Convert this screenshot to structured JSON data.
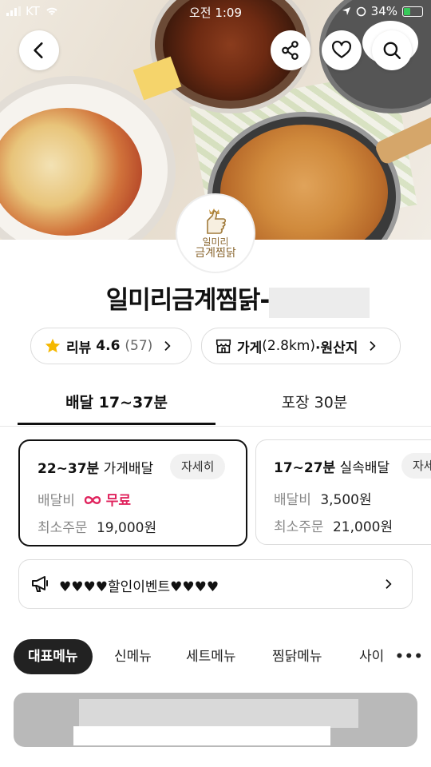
{
  "status_bar": {
    "carrier": "KT",
    "time": "오전 1:09",
    "battery": "34%"
  },
  "store": {
    "logo_text_1": "일미리",
    "logo_text_2": "금계찜닭",
    "name": "일미리금계찜닭-"
  },
  "review": {
    "label": "리뷰",
    "rating": "4.6",
    "count": "(57)"
  },
  "store_info": {
    "prefix": "가게",
    "distance": "(2.8km)",
    "suffix": "·원산지"
  },
  "tabs": {
    "delivery": "배달 17~37분",
    "pickup": "포장 30분"
  },
  "delivery_options": [
    {
      "time": "22~37분",
      "type": "가게배달",
      "detail": "자세히",
      "fee_label": "배달비",
      "fee_value": "무료",
      "min_label": "최소주문",
      "min_value": "19,000원"
    },
    {
      "time": "17~27분",
      "type": "실속배달",
      "detail": "자세",
      "fee_label": "배달비",
      "fee_value": "3,500원",
      "min_label": "최소주문",
      "min_value": "21,000원"
    }
  ],
  "event": {
    "text": "♥♥♥♥할인이벤트♥♥♥♥"
  },
  "menu_categories": [
    "대표메뉴",
    "신메뉴",
    "세트메뉴",
    "찜닭메뉴",
    "사이"
  ],
  "colors": {
    "free": "#e0245e",
    "star": "#f5b800",
    "active_chip": "#222222"
  }
}
